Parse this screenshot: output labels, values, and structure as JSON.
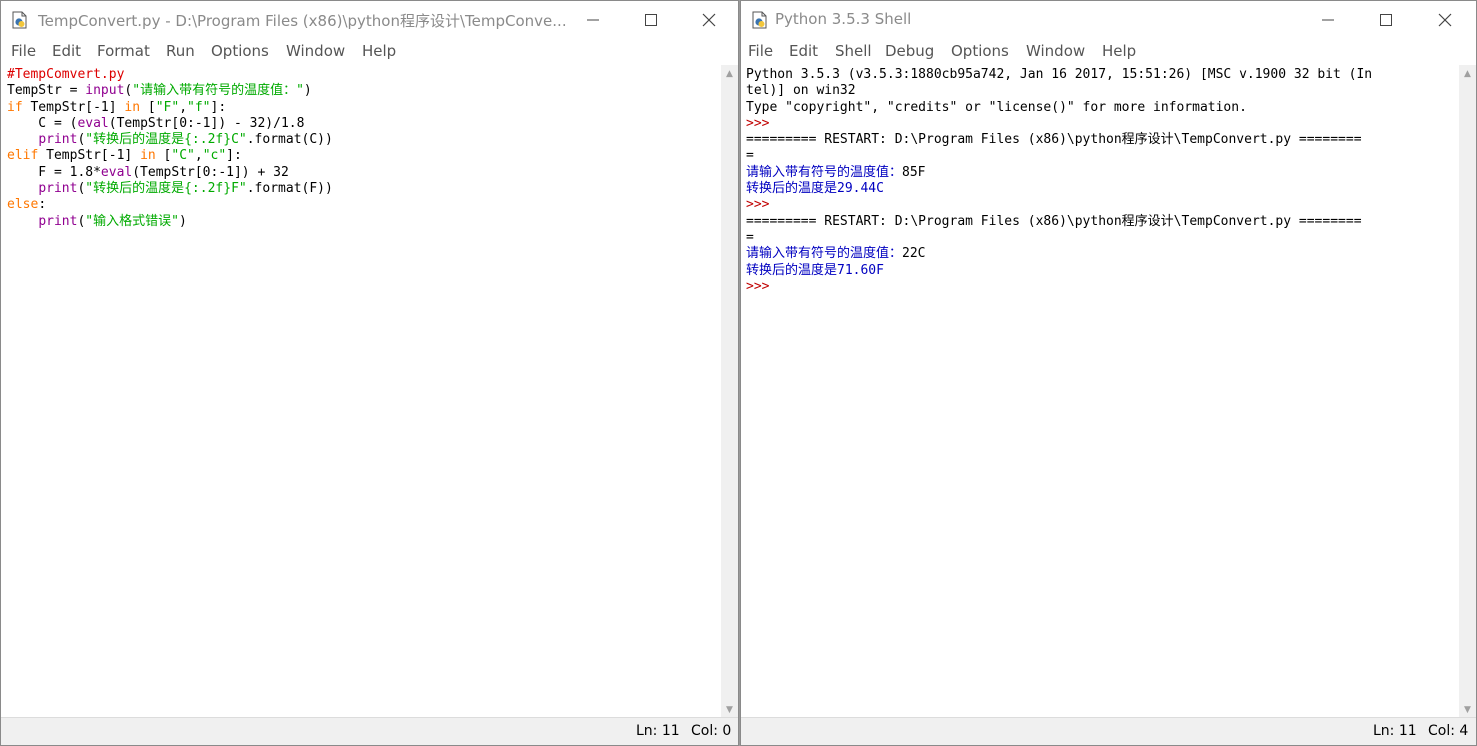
{
  "editor": {
    "title": "TempConvert.py - D:\\Program Files (x86)\\python程序设计\\TempConve...",
    "menu": [
      "File",
      "Edit",
      "Format",
      "Run",
      "Options",
      "Window",
      "Help"
    ],
    "code_lines": [
      [
        {
          "t": "#TempComvert.py",
          "c": "comment"
        }
      ],
      [
        {
          "t": "TempStr = ",
          "c": "def"
        },
        {
          "t": "input",
          "c": "bi"
        },
        {
          "t": "(",
          "c": "def"
        },
        {
          "t": "\"请输入带有符号的温度值：\"",
          "c": "str"
        },
        {
          "t": ")",
          "c": "def"
        }
      ],
      [
        {
          "t": "if",
          "c": "kw"
        },
        {
          "t": " TempStr[-1] ",
          "c": "def"
        },
        {
          "t": "in",
          "c": "kw"
        },
        {
          "t": " [",
          "c": "def"
        },
        {
          "t": "\"F\"",
          "c": "str"
        },
        {
          "t": ",",
          "c": "def"
        },
        {
          "t": "\"f\"",
          "c": "str"
        },
        {
          "t": "]:",
          "c": "def"
        }
      ],
      [
        {
          "t": "    C = (",
          "c": "def"
        },
        {
          "t": "eval",
          "c": "bi"
        },
        {
          "t": "(TempStr[0:-1]) - 32)/1.8",
          "c": "def"
        }
      ],
      [
        {
          "t": "    ",
          "c": "def"
        },
        {
          "t": "print",
          "c": "bi"
        },
        {
          "t": "(",
          "c": "def"
        },
        {
          "t": "\"转换后的温度是{:.2f}C\"",
          "c": "str"
        },
        {
          "t": ".format(C))",
          "c": "def"
        }
      ],
      [
        {
          "t": "elif",
          "c": "kw"
        },
        {
          "t": " TempStr[-1] ",
          "c": "def"
        },
        {
          "t": "in",
          "c": "kw"
        },
        {
          "t": " [",
          "c": "def"
        },
        {
          "t": "\"C\"",
          "c": "str"
        },
        {
          "t": ",",
          "c": "def"
        },
        {
          "t": "\"c\"",
          "c": "str"
        },
        {
          "t": "]:",
          "c": "def"
        }
      ],
      [
        {
          "t": "    F = 1.8*",
          "c": "def"
        },
        {
          "t": "eval",
          "c": "bi"
        },
        {
          "t": "(TempStr[0:-1]) + 32",
          "c": "def"
        }
      ],
      [
        {
          "t": "    ",
          "c": "def"
        },
        {
          "t": "print",
          "c": "bi"
        },
        {
          "t": "(",
          "c": "def"
        },
        {
          "t": "\"转换后的温度是{:.2f}F\"",
          "c": "str"
        },
        {
          "t": ".format(F))",
          "c": "def"
        }
      ],
      [
        {
          "t": "else",
          "c": "kw"
        },
        {
          "t": ":",
          "c": "def"
        }
      ],
      [
        {
          "t": "    ",
          "c": "def"
        },
        {
          "t": "print",
          "c": "bi"
        },
        {
          "t": "(",
          "c": "def"
        },
        {
          "t": "\"输入格式错误\"",
          "c": "str"
        },
        {
          "t": ")",
          "c": "def"
        }
      ]
    ],
    "status": {
      "ln": "Ln: 11",
      "col": "Col: 0"
    }
  },
  "shell": {
    "title": "Python 3.5.3 Shell",
    "menu": [
      "File",
      "Edit",
      "Shell",
      "Debug",
      "Options",
      "Window",
      "Help"
    ],
    "lines": [
      [
        {
          "t": "Python 3.5.3 (v3.5.3:1880cb95a742, Jan 16 2017, 15:51:26) [MSC v.1900 32 bit (In",
          "c": "def"
        }
      ],
      [
        {
          "t": "tel)] on win32",
          "c": "def"
        }
      ],
      [
        {
          "t": "Type \"copyright\", \"credits\" or \"license()\" for more information.",
          "c": "def"
        }
      ],
      [
        {
          "t": ">>> ",
          "c": "prompt"
        }
      ],
      [
        {
          "t": "========= RESTART: D:\\Program Files (x86)\\python程序设计\\TempConvert.py ========",
          "c": "def"
        }
      ],
      [
        {
          "t": "=",
          "c": "def"
        }
      ],
      [
        {
          "t": "请输入带有符号的温度值：",
          "c": "out"
        },
        {
          "t": "85F",
          "c": "def"
        }
      ],
      [
        {
          "t": "转换后的温度是29.44C",
          "c": "out"
        }
      ],
      [
        {
          "t": ">>> ",
          "c": "prompt"
        }
      ],
      [
        {
          "t": "========= RESTART: D:\\Program Files (x86)\\python程序设计\\TempConvert.py ========",
          "c": "def"
        }
      ],
      [
        {
          "t": "=",
          "c": "def"
        }
      ],
      [
        {
          "t": "请输入带有符号的温度值：",
          "c": "out"
        },
        {
          "t": "22C",
          "c": "def"
        }
      ],
      [
        {
          "t": "转换后的温度是71.60F",
          "c": "out"
        }
      ],
      [
        {
          "t": ">>> ",
          "c": "prompt"
        }
      ]
    ],
    "status": {
      "ln": "Ln: 11",
      "col": "Col: 4"
    }
  },
  "colors": {
    "comment": "#dd0000",
    "keyword": "#ff7700",
    "builtin": "#900090",
    "string": "#00aa00",
    "prompt": "#c00000",
    "stdout": "#0000c0"
  },
  "icons": [
    "python-file-icon",
    "minimize-icon",
    "maximize-icon",
    "close-icon",
    "scroll-up-arrow-icon",
    "scroll-down-arrow-icon"
  ]
}
